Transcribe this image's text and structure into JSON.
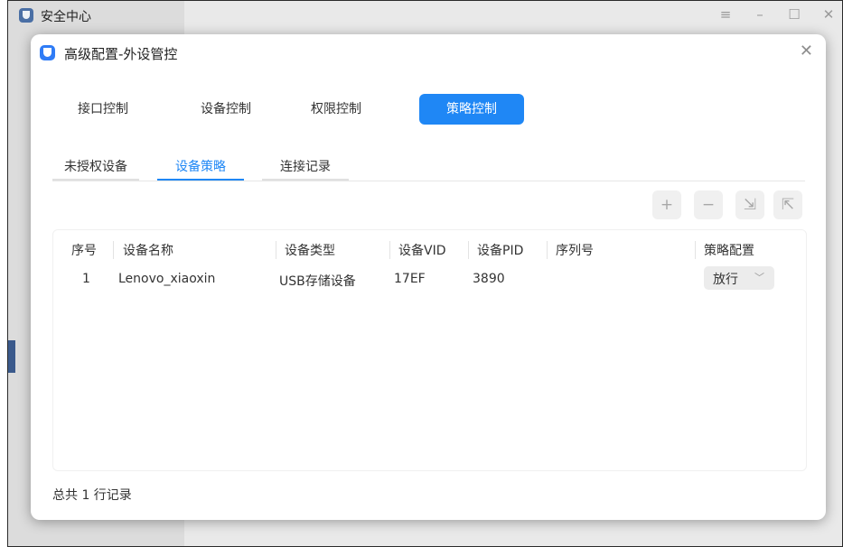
{
  "app": {
    "title": "安全中心",
    "window_controls": [
      "≡",
      "–",
      "☐",
      "✕"
    ]
  },
  "dialog": {
    "title": "高级配置-外设管控",
    "close": "✕"
  },
  "top_tabs": [
    {
      "label": "接口控制",
      "active": false
    },
    {
      "label": "设备控制",
      "active": false
    },
    {
      "label": "权限控制",
      "active": false
    },
    {
      "label": "策略控制",
      "active": true
    }
  ],
  "sub_tabs": [
    {
      "label": "未授权设备",
      "active": false
    },
    {
      "label": "设备策略",
      "active": true
    },
    {
      "label": "连接记录",
      "active": false
    }
  ],
  "toolbar": {
    "add": "+",
    "remove": "−",
    "import": "⇲",
    "export": "⇱"
  },
  "table": {
    "columns": [
      "序号",
      "设备名称",
      "设备类型",
      "设备VID",
      "设备PID",
      "序列号",
      "策略配置"
    ],
    "rows": [
      {
        "index": "1",
        "name": "Lenovo_xiaoxin",
        "type": "USB存储设备",
        "vid": "17EF",
        "pid": "3890",
        "serial": "",
        "policy": "放行"
      }
    ]
  },
  "footer": {
    "summary": "总共 1 行记录"
  },
  "colors": {
    "accent": "#1f87f5",
    "sidebar_selected": "#3b5a8c"
  }
}
